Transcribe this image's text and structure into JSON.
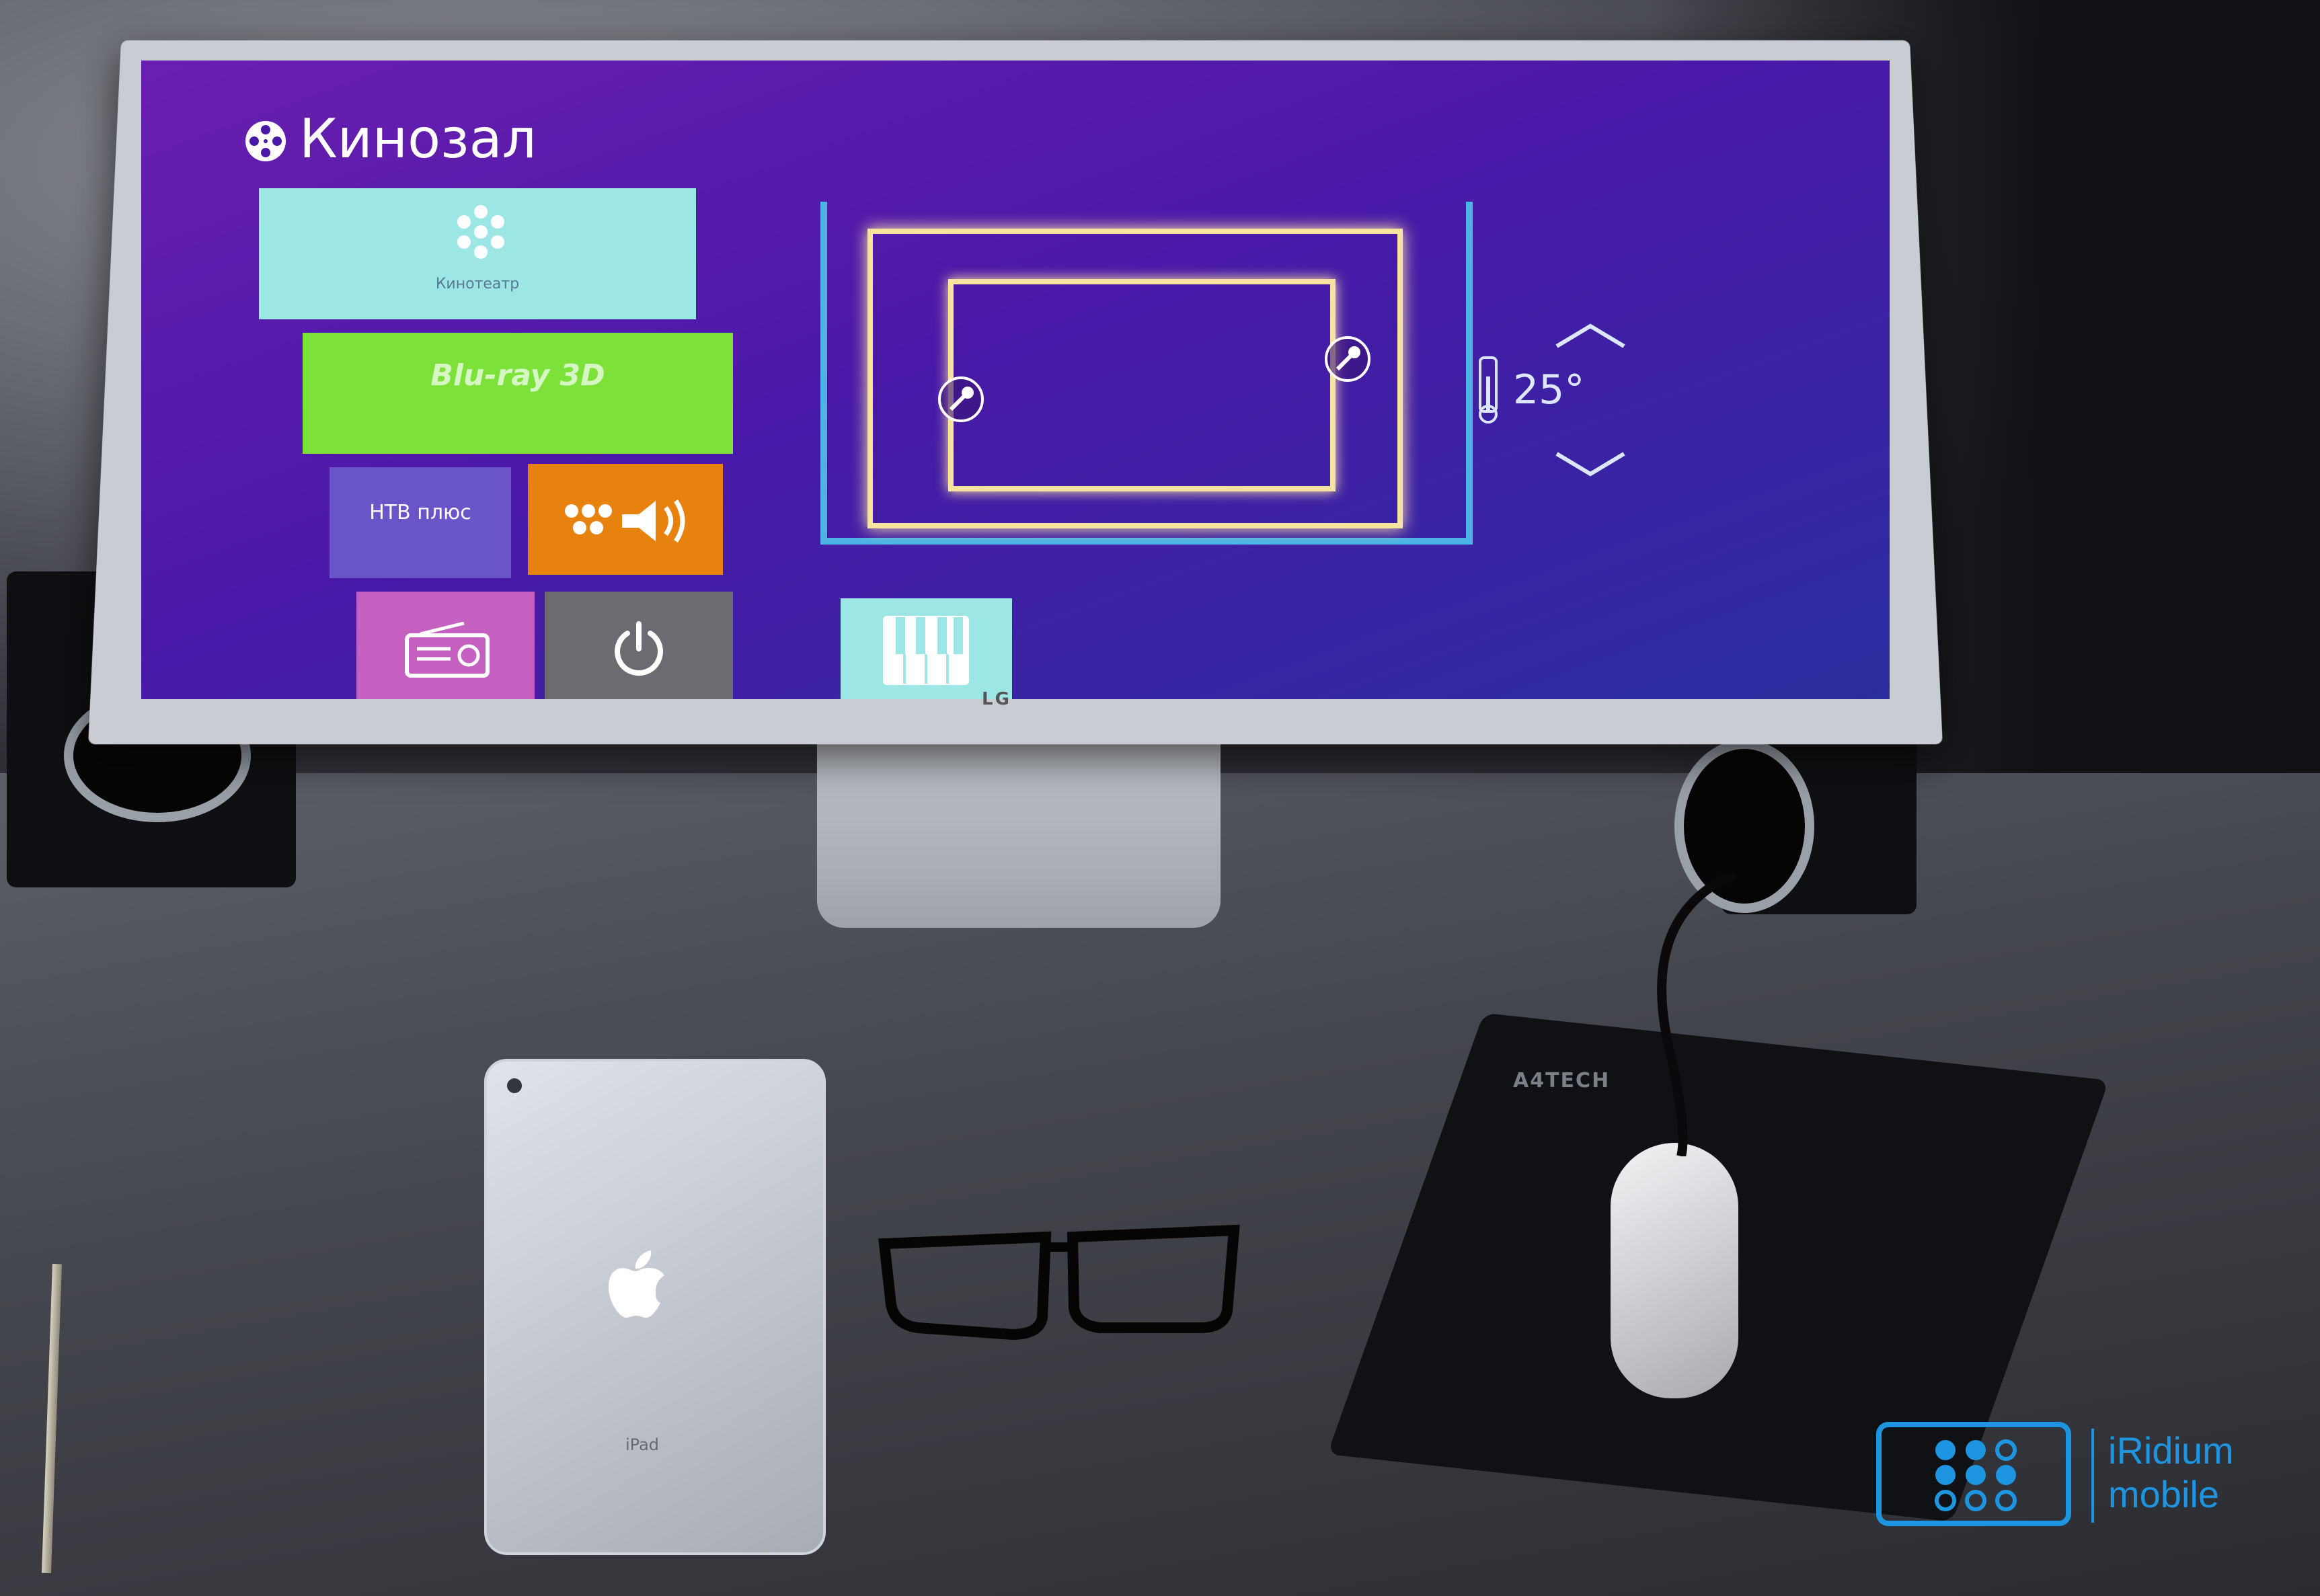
{
  "app": {
    "title": "Кинозал"
  },
  "tiles": {
    "cinema_label": "Кинотеатр",
    "bluray_label": "Blu-ray 3D",
    "ntv_label": "НТВ плюс",
    "audio": "audio",
    "radio": "radio",
    "power": "power",
    "piano": "piano"
  },
  "climate": {
    "temperature": "25°"
  },
  "monitor": {
    "brand": "LG"
  },
  "desk": {
    "ipad_label": "iPad",
    "mousepad_brand": "A4TECH"
  },
  "logo": {
    "line1": "iRidium",
    "line2": "mobile"
  },
  "colors": {
    "screen_bg": "#4a18a8",
    "tile_cyan": "#9ce6e6",
    "tile_green": "#7ce23a",
    "tile_orange": "#e8820f",
    "tile_purple": "#6a55c8",
    "tile_pink": "#c560c0",
    "tile_gray": "#6d6a72",
    "room_blue": "#4db2e6",
    "room_light": "#f6e3a0",
    "logo_blue": "#1e95e0"
  },
  "icons": [
    "film-reel-icon",
    "bluray-icon",
    "ntv-icon",
    "audio-icon",
    "radio-icon",
    "power-icon",
    "piano-icon",
    "dimmer-icon",
    "thermometer-icon",
    "chevron-up-icon",
    "chevron-down-icon",
    "apple-icon",
    "iridium-logo-icon"
  ]
}
